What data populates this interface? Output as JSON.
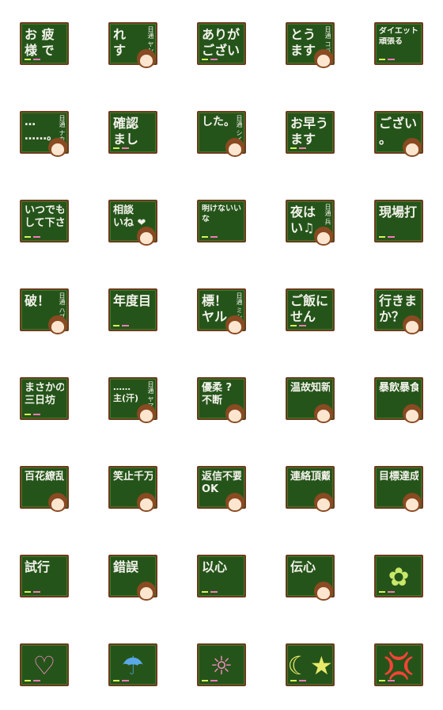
{
  "colors": {
    "board": "#25541a",
    "frame": "#6b3a1e",
    "chalk": "#f2f2ea",
    "hair": "#8a4a22"
  },
  "stickers": [
    {
      "lines": [
        "お 疲",
        "様 で"
      ],
      "side": "",
      "character": false
    },
    {
      "lines": [
        "れ",
        "す"
      ],
      "side": "日通 ヤン",
      "character": true
    },
    {
      "lines": [
        "ありが",
        "ござい"
      ],
      "side": "",
      "character": false
    },
    {
      "lines": [
        "とう",
        "ます"
      ],
      "side": "日通 コバ",
      "character": true
    },
    {
      "lines": [
        "ダイエット",
        "頑張る"
      ],
      "side": "",
      "character": false
    },
    {
      "lines": [
        "…",
        "……。"
      ],
      "side": "日通 ナカ",
      "character": true
    },
    {
      "lines": [
        "確認",
        "まし"
      ],
      "side": "",
      "character": false
    },
    {
      "lines": [
        "した。"
      ],
      "side": "日通 シイ",
      "character": true
    },
    {
      "lines": [
        "お早う",
        "ます"
      ],
      "side": "",
      "character": false
    },
    {
      "lines": [
        "ござい",
        "。"
      ],
      "side": "",
      "character": true
    },
    {
      "lines": [
        "いつでも",
        "して下さ"
      ],
      "side": "",
      "character": false
    },
    {
      "lines": [
        "相談",
        "いね ❤"
      ],
      "side": "",
      "character": true
    },
    {
      "lines": [
        "明けないい",
        "な"
      ],
      "side": "",
      "character": false
    },
    {
      "lines": [
        "夜は",
        "い♫"
      ],
      "side": "日通 兵",
      "character": true
    },
    {
      "lines": [
        "現場打"
      ],
      "side": "",
      "character": false
    },
    {
      "lines": [
        "破！"
      ],
      "side": "日通 ハブ",
      "character": true
    },
    {
      "lines": [
        "年度目"
      ],
      "side": "",
      "character": false
    },
    {
      "lines": [
        "標！",
        "ヤル"
      ],
      "side": "日通 ミシ",
      "character": true
    },
    {
      "lines": [
        "ご飯に",
        "せん"
      ],
      "side": "",
      "character": false
    },
    {
      "lines": [
        "行きま",
        "か？"
      ],
      "side": "",
      "character": true
    },
    {
      "lines": [
        "まさかの",
        "三日坊"
      ],
      "side": "",
      "character": false
    },
    {
      "lines": [
        "……",
        "主(汗)"
      ],
      "side": "日通 ヤマ",
      "character": true
    },
    {
      "lines": [
        "優柔 ?",
        "不断"
      ],
      "side": "",
      "character": true
    },
    {
      "lines": [
        "温故知新"
      ],
      "side": "",
      "character": true
    },
    {
      "lines": [
        "暴飲暴食"
      ],
      "side": "",
      "character": true
    },
    {
      "lines": [
        "百花繚乱"
      ],
      "side": "",
      "character": true
    },
    {
      "lines": [
        "笑止千万"
      ],
      "side": "",
      "character": true
    },
    {
      "lines": [
        "返信不要",
        "OK"
      ],
      "side": "",
      "character": true
    },
    {
      "lines": [
        "連絡頂戴"
      ],
      "side": "",
      "character": true
    },
    {
      "lines": [
        "目標達成"
      ],
      "side": "",
      "character": true
    },
    {
      "lines": [
        "試行"
      ],
      "side": "",
      "character": false
    },
    {
      "lines": [
        "錯誤"
      ],
      "side": "",
      "character": true
    },
    {
      "lines": [
        "以心"
      ],
      "side": "",
      "character": false
    },
    {
      "lines": [
        "伝心"
      ],
      "side": "",
      "character": true
    },
    {
      "lines": [],
      "side": "",
      "character": false,
      "icon": "flower-icon",
      "glyph": "✿",
      "icon_color": "#c8e86a"
    },
    {
      "lines": [],
      "side": "",
      "character": false,
      "icon": "heart-icon",
      "glyph": "♡",
      "icon_color": "#f58ac0"
    },
    {
      "lines": [],
      "side": "",
      "character": false,
      "icon": "umbrella-icon",
      "glyph": "☂",
      "icon_color": "#5aa8e8"
    },
    {
      "lines": [],
      "side": "",
      "character": false,
      "icon": "sun-icon",
      "glyph": "☼",
      "icon_color": "#f58ac0"
    },
    {
      "lines": [],
      "side": "",
      "character": false,
      "icon": "moon-star-icon",
      "glyph": "☾★",
      "icon_color": "#e8e86a"
    },
    {
      "lines": [],
      "side": "",
      "character": false,
      "icon": "anger-icon",
      "glyph": "💢",
      "icon_color": "#f2f2ea"
    }
  ]
}
